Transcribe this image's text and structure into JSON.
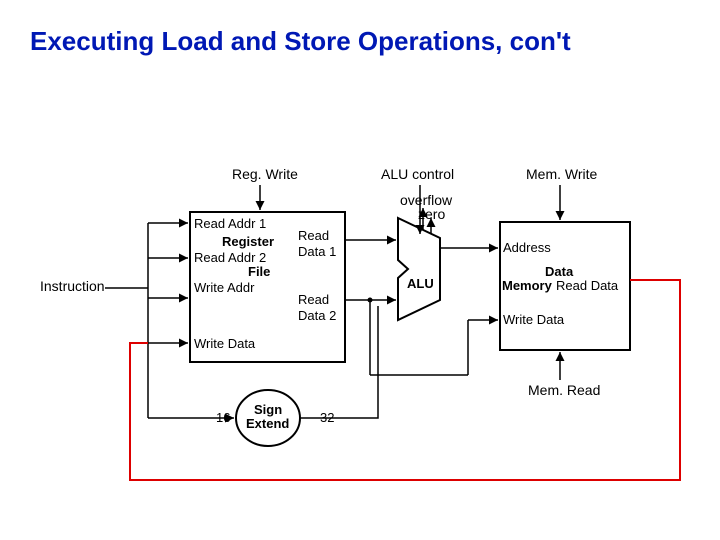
{
  "title": "Executing Load and Store Operations, con't",
  "signals": {
    "regwrite": "Reg. Write",
    "alucontrol": "ALU control",
    "memwrite": "Mem. Write",
    "memread": "Mem. Read",
    "instruction": "Instruction",
    "overflow": "overflow",
    "zero": "zero"
  },
  "regfile": {
    "name1": "Register",
    "name2": "File",
    "readaddr1": "Read Addr 1",
    "readaddr2": "Read Addr 2",
    "writeaddr": "Write Addr",
    "writedata": "Write Data",
    "readdata1_a": "Read",
    "readdata1_b": "Data 1",
    "readdata2_a": "Read",
    "readdata2_b": "Data 2"
  },
  "alu": {
    "label": "ALU"
  },
  "mem": {
    "name1": "Data",
    "name2": "Memory",
    "address": "Address",
    "writedata": "Write Data",
    "readdata": "Read Data"
  },
  "signext": {
    "line1": "Sign",
    "line2": "Extend",
    "in": "16",
    "out": "32"
  }
}
